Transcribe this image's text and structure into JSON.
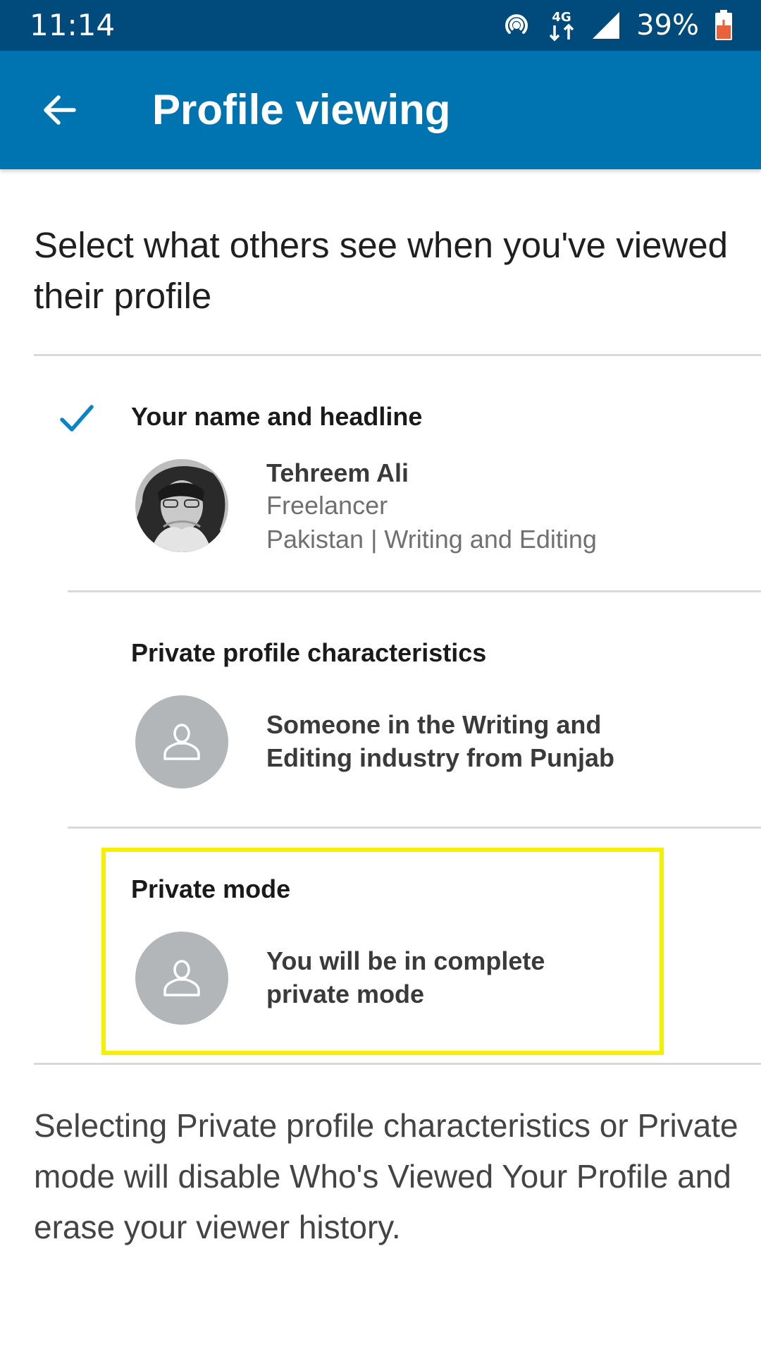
{
  "status_bar": {
    "time": "11:14",
    "network": "4G",
    "battery_percent": "39%",
    "icons": [
      "hotspot-icon",
      "4g-data-icon",
      "cell-signal-icon",
      "battery-charging-icon"
    ]
  },
  "app_bar": {
    "title": "Profile viewing",
    "back_icon": "arrow-left-icon"
  },
  "intro": "Select what others see when you've viewed their profile",
  "options": [
    {
      "title": "Your name and headline",
      "selected": true,
      "avatar": "profile-photo",
      "name": "Tehreem Ali",
      "headline": "Freelancer",
      "subtitle": "Pakistan | Writing and Editing"
    },
    {
      "title": "Private profile characteristics",
      "selected": false,
      "avatar": "generic-person-icon",
      "description": "Someone in the Writing and Editing industry from Punjab"
    },
    {
      "title": "Private mode",
      "selected": false,
      "avatar": "generic-person-icon",
      "description": "You will be in complete private mode"
    }
  ],
  "footer_note": "Selecting Private profile characteristics or Private mode will disable Who's Viewed Your Profile and erase your viewer history.",
  "colors": {
    "status_bar": "#004b7c",
    "app_bar": "#0073b1",
    "check": "#0a84c6",
    "highlight": "#f5f000",
    "divider": "#d9d9d9",
    "avatar_placeholder": "#b3b6b9"
  }
}
